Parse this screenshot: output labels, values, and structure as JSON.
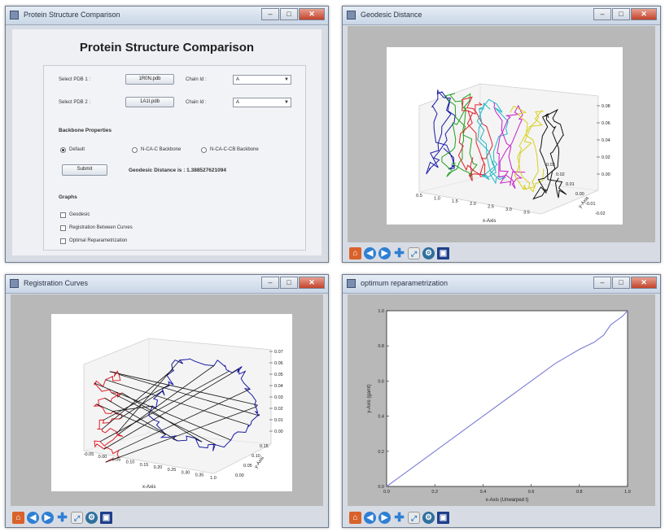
{
  "window1": {
    "title": "Protein Structure Comparison",
    "heading": "Protein Structure Comparison",
    "row1": {
      "label": "Select PDB 1 :",
      "button": "1R0N.pdb",
      "chain_label": "Chain Id :",
      "chain_value": "A"
    },
    "row2": {
      "label": "Select PDB 2 :",
      "button": "1A1I.pdb",
      "chain_label": "Chain Id :",
      "chain_value": "A"
    },
    "backbone_heading": "Backbone Properties",
    "radio_default": "Default",
    "radio_n_ca_c": "N-CA-C Backbone",
    "radio_n_ca_c_cb": "N-CA-C-CB Backbone",
    "submit_label": "Submit",
    "result_text": "Geodesic Distance is : 1.388527621094",
    "graphs_heading": "Graphs",
    "check_geodesic": "Geodesic",
    "check_registration": "Registration Between Curves",
    "check_optimal": "Optimal Reparametrization"
  },
  "window2": {
    "title": "Geodesic Distance",
    "xaxis_label": "x-Axis",
    "yaxis_label": "y-Axis",
    "x_ticks": [
      "0.5",
      "1.0",
      "1.5",
      "2.0",
      "2.5",
      "3.0",
      "3.5"
    ],
    "y_ticks": [
      "-0.02",
      "-0.01",
      "0.00",
      "0.01",
      "0.02",
      "0.03"
    ],
    "z_ticks": [
      "0.00",
      "0.02",
      "0.04",
      "0.06",
      "0.08"
    ],
    "colors": [
      "#1a1aa8",
      "#1ea01e",
      "#e0202a",
      "#20b8c8",
      "#c820c8",
      "#d8d020",
      "#111111"
    ]
  },
  "window3": {
    "title": "Registration Curves",
    "xaxis_label": "x-Axis",
    "yaxis_label": "y-Axis",
    "x_ticks": [
      "-0.05",
      "0.00",
      "0.05",
      "0.10",
      "0.15",
      "0.20",
      "0.25",
      "0.30",
      "0.35",
      "1.0"
    ],
    "y_ticks": [
      "0.00",
      "0.05",
      "0.10",
      "0.15"
    ],
    "z_ticks": [
      "0.00",
      "0.01",
      "0.02",
      "0.03",
      "0.04",
      "0.05",
      "0.06",
      "0.07"
    ],
    "colors": [
      "#e0202a",
      "#1a1aa8",
      "#111111"
    ]
  },
  "window4": {
    "title": "optimum reparametrization",
    "xaxis_label": "x-Axis (Unwarped t)",
    "yaxis_label": "y-Axis (gamt)",
    "x_ticks": [
      "0.0",
      "0.2",
      "0.4",
      "0.6",
      "0.8",
      "1.0"
    ],
    "y_ticks": [
      "0.0",
      "0.2",
      "0.4",
      "0.6",
      "0.8",
      "1.0"
    ],
    "line_color": "#7b7bd6"
  },
  "chart_data": {
    "type": "line",
    "title": "",
    "xlabel": "x-Axis (Unwarped t)",
    "ylabel": "y-Axis (gamt)",
    "xlim": [
      0,
      1
    ],
    "ylim": [
      0,
      1
    ],
    "series": [
      {
        "x": [
          0.0,
          0.05,
          0.1,
          0.2,
          0.3,
          0.4,
          0.5,
          0.6,
          0.66,
          0.7,
          0.75,
          0.8,
          0.86,
          0.9,
          0.93,
          0.96,
          0.98,
          1.0
        ],
        "values": [
          0.0,
          0.05,
          0.1,
          0.2,
          0.3,
          0.4,
          0.5,
          0.6,
          0.66,
          0.7,
          0.74,
          0.78,
          0.82,
          0.86,
          0.92,
          0.95,
          0.97,
          1.0
        ]
      }
    ]
  },
  "toolbar": {
    "home": "home-icon",
    "back": "back-arrow-icon",
    "forward": "forward-arrow-icon",
    "pan": "pan-icon",
    "zoom": "zoom-icon",
    "configure": "configure-subplots-icon",
    "save": "save-icon"
  }
}
